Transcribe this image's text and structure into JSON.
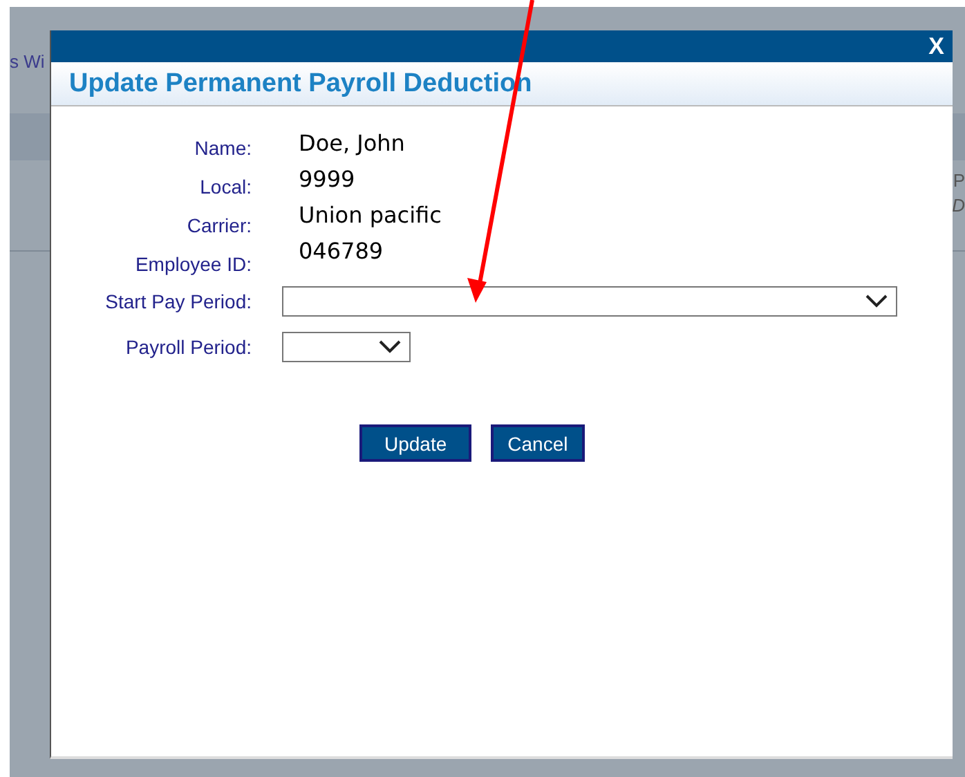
{
  "background": {
    "texts": [
      "s Wi",
      "P",
      "D"
    ]
  },
  "dialog": {
    "close": "X",
    "title": "Update Permanent Payroll Deduction",
    "fields": [
      {
        "label": "Name:",
        "value": "Doe, John"
      },
      {
        "label": "Local:",
        "value": "9999"
      },
      {
        "label": "Carrier:",
        "value": "Union pacific"
      },
      {
        "label": "Employee ID:",
        "value": "046789"
      }
    ],
    "selects": [
      {
        "label": "Start Pay Period:",
        "kind": "wide"
      },
      {
        "label": "Payroll Period:",
        "kind": "narrow"
      }
    ],
    "buttons": [
      "Update",
      "Cancel"
    ]
  }
}
